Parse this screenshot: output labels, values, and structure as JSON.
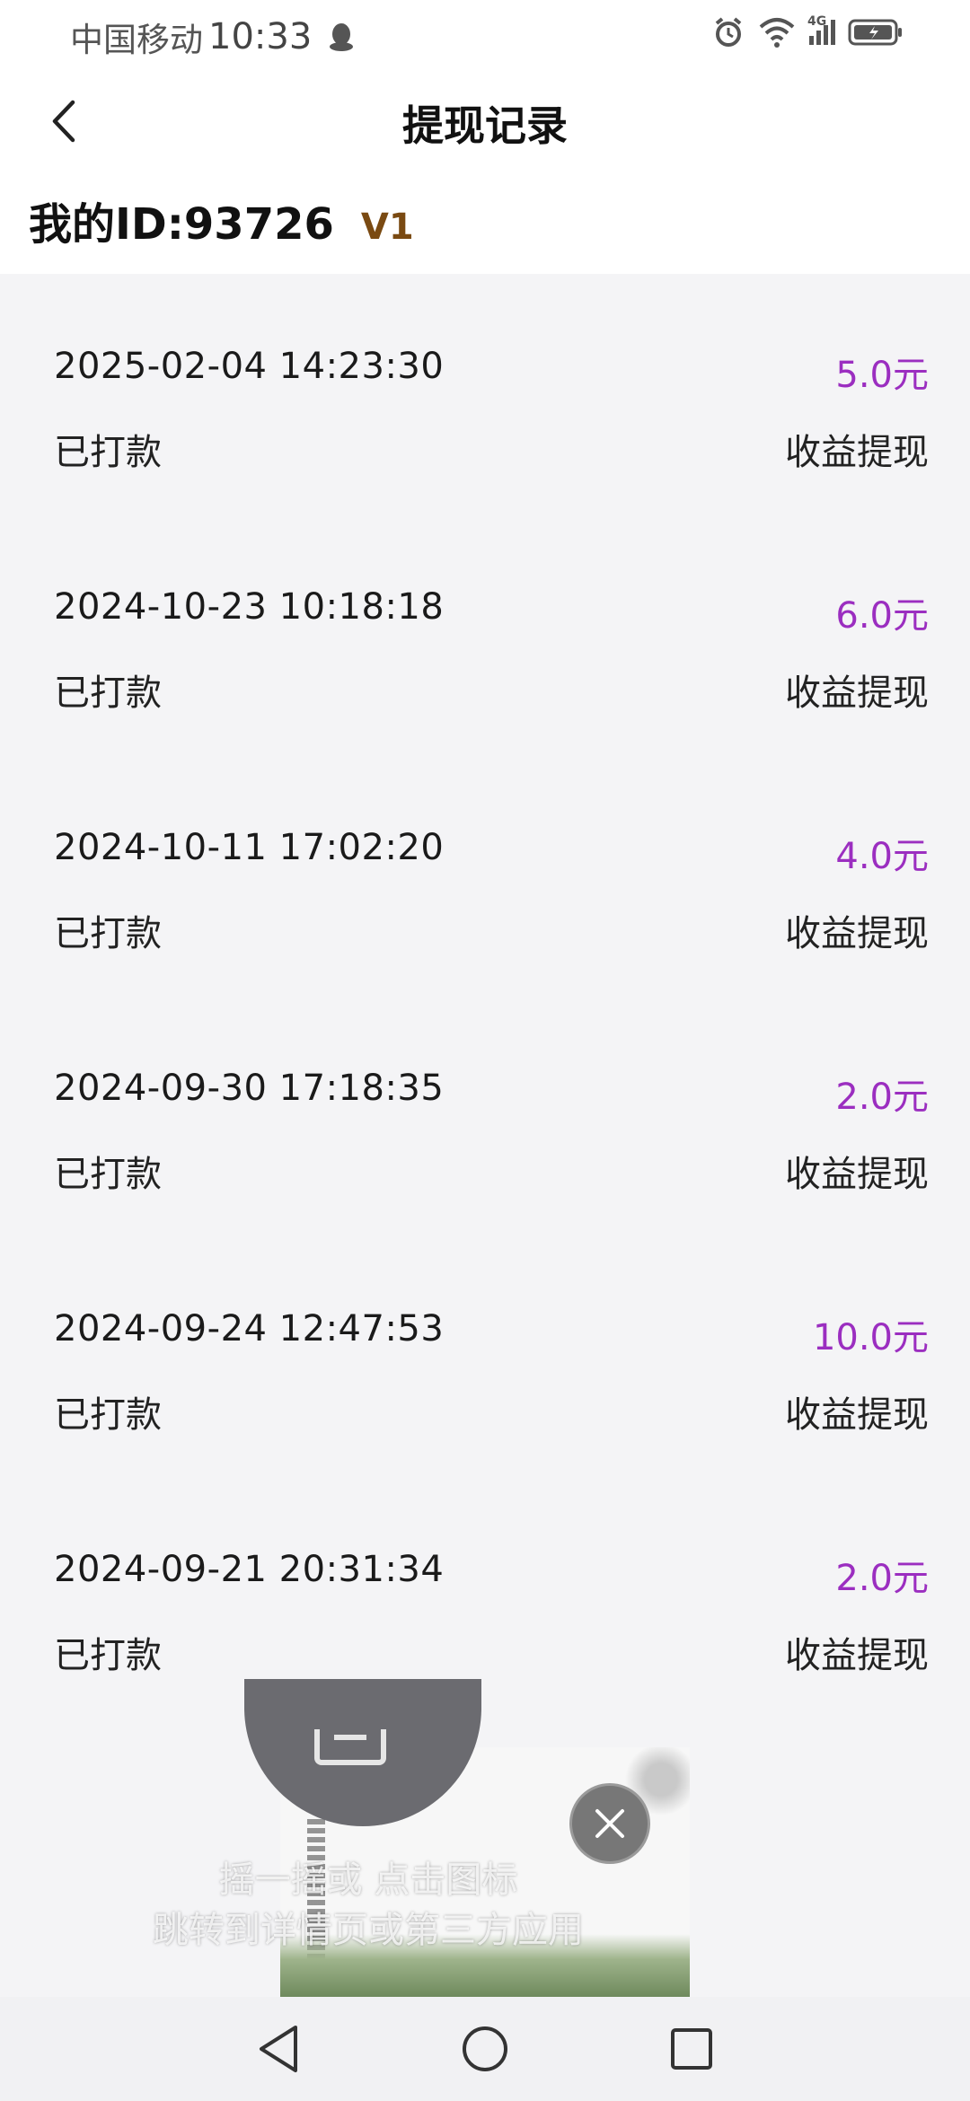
{
  "status_bar": {
    "carrier": "中国移动",
    "time": "10:33",
    "network": "4G"
  },
  "header": {
    "title": "提现记录"
  },
  "user": {
    "id_label": "我的ID:93726",
    "level": "V1"
  },
  "records": [
    {
      "date": "2025-02-04 14:23:30",
      "amount": "5.0元",
      "status": "已打款",
      "type": "收益提现"
    },
    {
      "date": "2024-10-23 10:18:18",
      "amount": "6.0元",
      "status": "已打款",
      "type": "收益提现"
    },
    {
      "date": "2024-10-11 17:02:20",
      "amount": "4.0元",
      "status": "已打款",
      "type": "收益提现"
    },
    {
      "date": "2024-09-30 17:18:35",
      "amount": "2.0元",
      "status": "已打款",
      "type": "收益提现"
    },
    {
      "date": "2024-09-24 12:47:53",
      "amount": "10.0元",
      "status": "已打款",
      "type": "收益提现"
    },
    {
      "date": "2024-09-21 20:31:34",
      "amount": "2.0元",
      "status": "已打款",
      "type": "收益提现"
    }
  ],
  "ad": {
    "hint_line1": "摇一摇或 点击图标",
    "hint_line2": "跳转到详情页或第三方应用"
  },
  "colors": {
    "amount": "#9b2ec0",
    "level": "#7a4a12",
    "background": "#f4f4f6"
  }
}
